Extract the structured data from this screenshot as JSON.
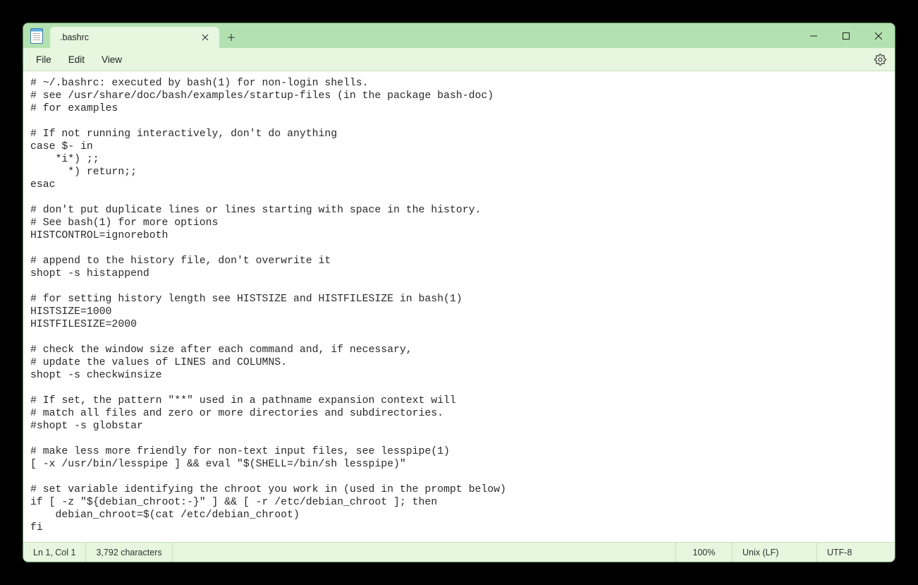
{
  "tab": {
    "title": ".bashrc"
  },
  "menu": {
    "file": "File",
    "edit": "Edit",
    "view": "View"
  },
  "editor": {
    "content": "# ~/.bashrc: executed by bash(1) for non-login shells.\n# see /usr/share/doc/bash/examples/startup-files (in the package bash-doc)\n# for examples\n\n# If not running interactively, don't do anything\ncase $- in\n    *i*) ;;\n      *) return;;\nesac\n\n# don't put duplicate lines or lines starting with space in the history.\n# See bash(1) for more options\nHISTCONTROL=ignoreboth\n\n# append to the history file, don't overwrite it\nshopt -s histappend\n\n# for setting history length see HISTSIZE and HISTFILESIZE in bash(1)\nHISTSIZE=1000\nHISTFILESIZE=2000\n\n# check the window size after each command and, if necessary,\n# update the values of LINES and COLUMNS.\nshopt -s checkwinsize\n\n# If set, the pattern \"**\" used in a pathname expansion context will\n# match all files and zero or more directories and subdirectories.\n#shopt -s globstar\n\n# make less more friendly for non-text input files, see lesspipe(1)\n[ -x /usr/bin/lesspipe ] && eval \"$(SHELL=/bin/sh lesspipe)\"\n\n# set variable identifying the chroot you work in (used in the prompt below)\nif [ -z \"${debian_chroot:-}\" ] && [ -r /etc/debian_chroot ]; then\n    debian_chroot=$(cat /etc/debian_chroot)\nfi"
  },
  "status": {
    "position": "Ln 1, Col 1",
    "characters": "3,792 characters",
    "zoom": "100%",
    "line_ending": "Unix (LF)",
    "encoding": "UTF-8"
  }
}
